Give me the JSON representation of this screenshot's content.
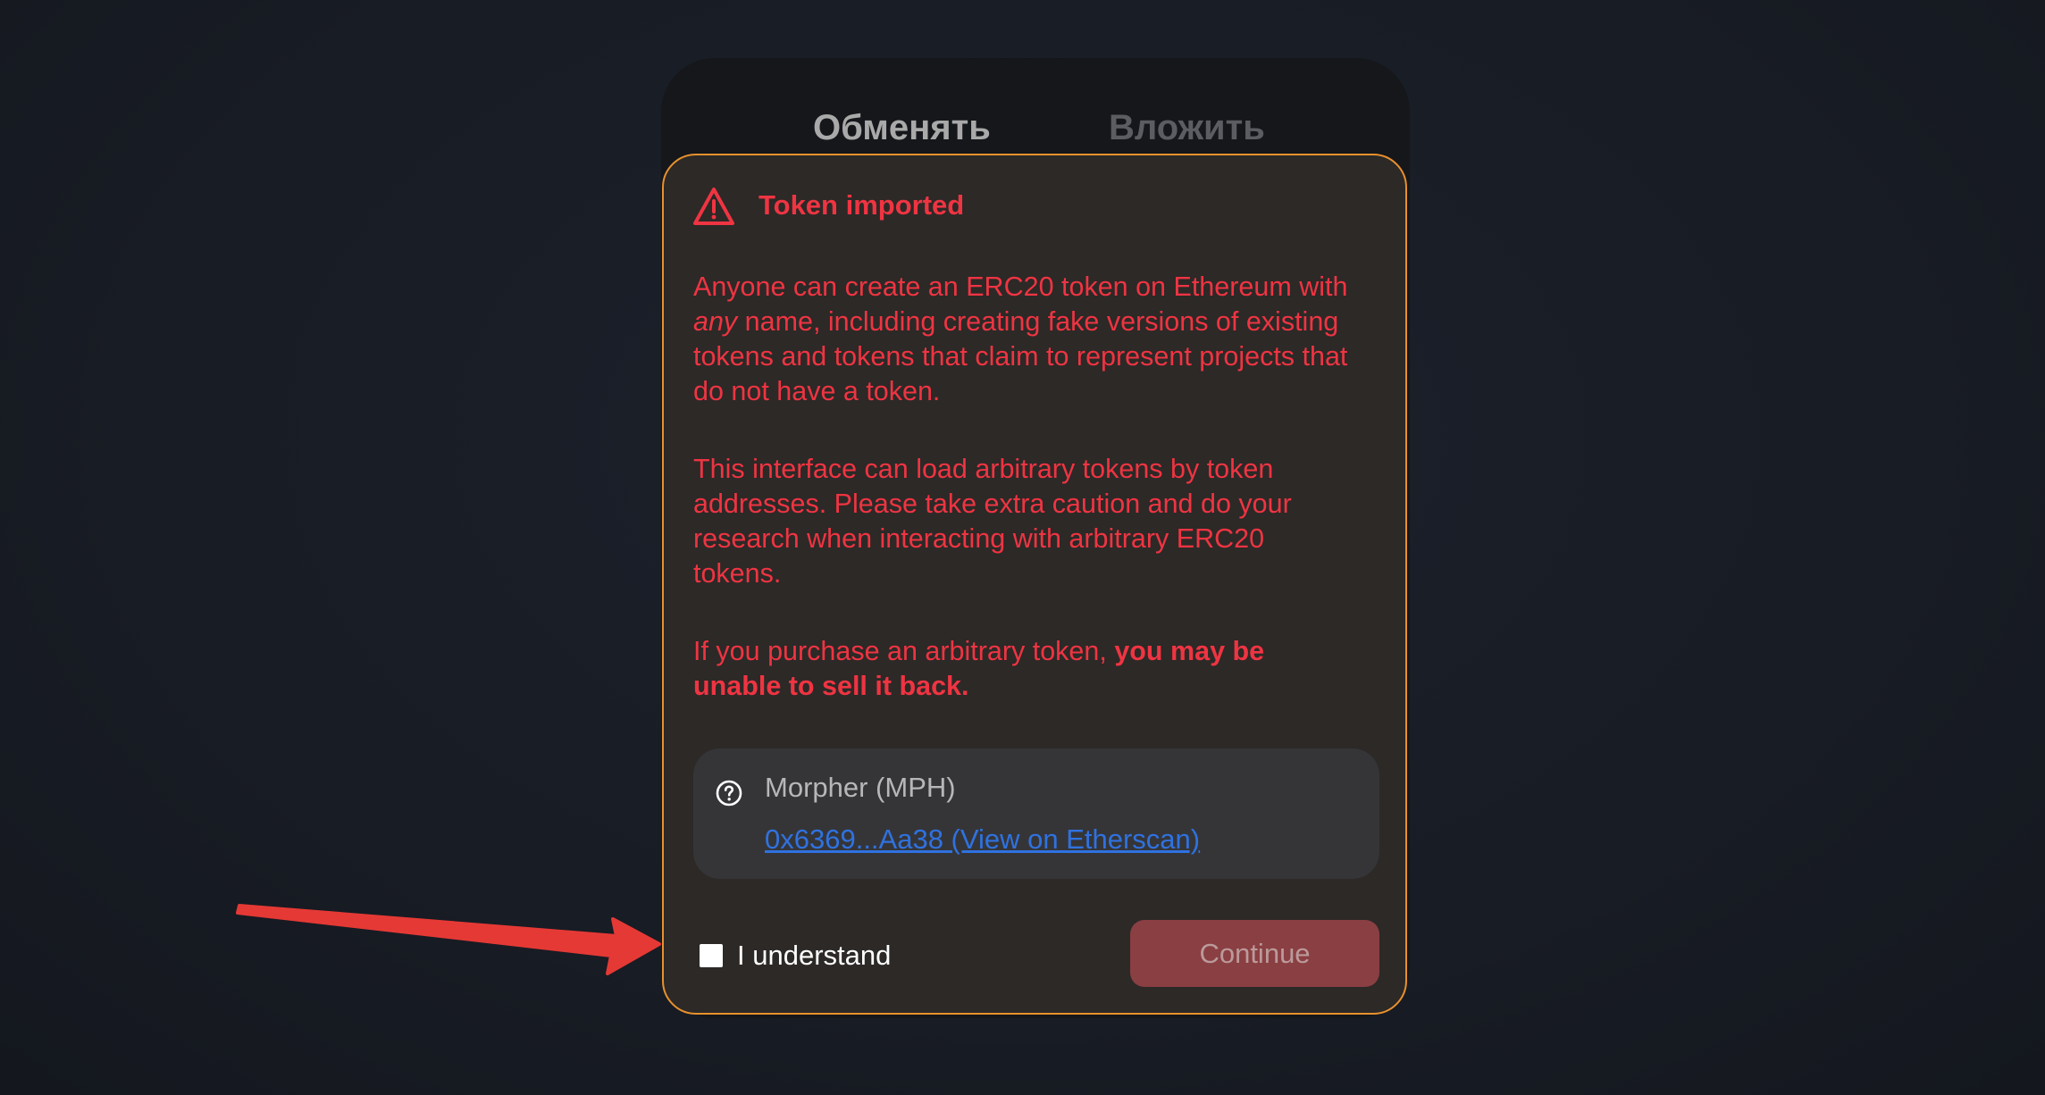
{
  "tabs": {
    "swap": "Обменять",
    "invest": "Вложить"
  },
  "warning": {
    "title": "Token imported",
    "p1_before": "Anyone can create an ERC20 token on Ethereum with ",
    "p1_emph": "any",
    "p1_after": " name, including creating fake versions of existing tokens and tokens that claim to represent projects that do not have a token.",
    "p2": "This interface can load arbitrary tokens by token addresses. Please take extra caution and do your research when interacting with arbitrary ERC20 tokens.",
    "p3_before": "If you purchase an arbitrary token, ",
    "p3_strong": "you may be unable to sell it back."
  },
  "token": {
    "name": "Morpher (MPH)",
    "link": "0x6369...Aa38 (View on Etherscan)"
  },
  "footer": {
    "checkbox_label": "I understand",
    "continue_label": "Continue"
  },
  "colors": {
    "warning_red": "#ef3442",
    "modal_border": "#e8912d",
    "link_blue": "#2f72e0",
    "arrow_red": "#e53935"
  },
  "icons": {
    "warning": "warning-triangle-icon",
    "help": "question-circle-icon",
    "arrow": "red-arrow-annotation"
  }
}
